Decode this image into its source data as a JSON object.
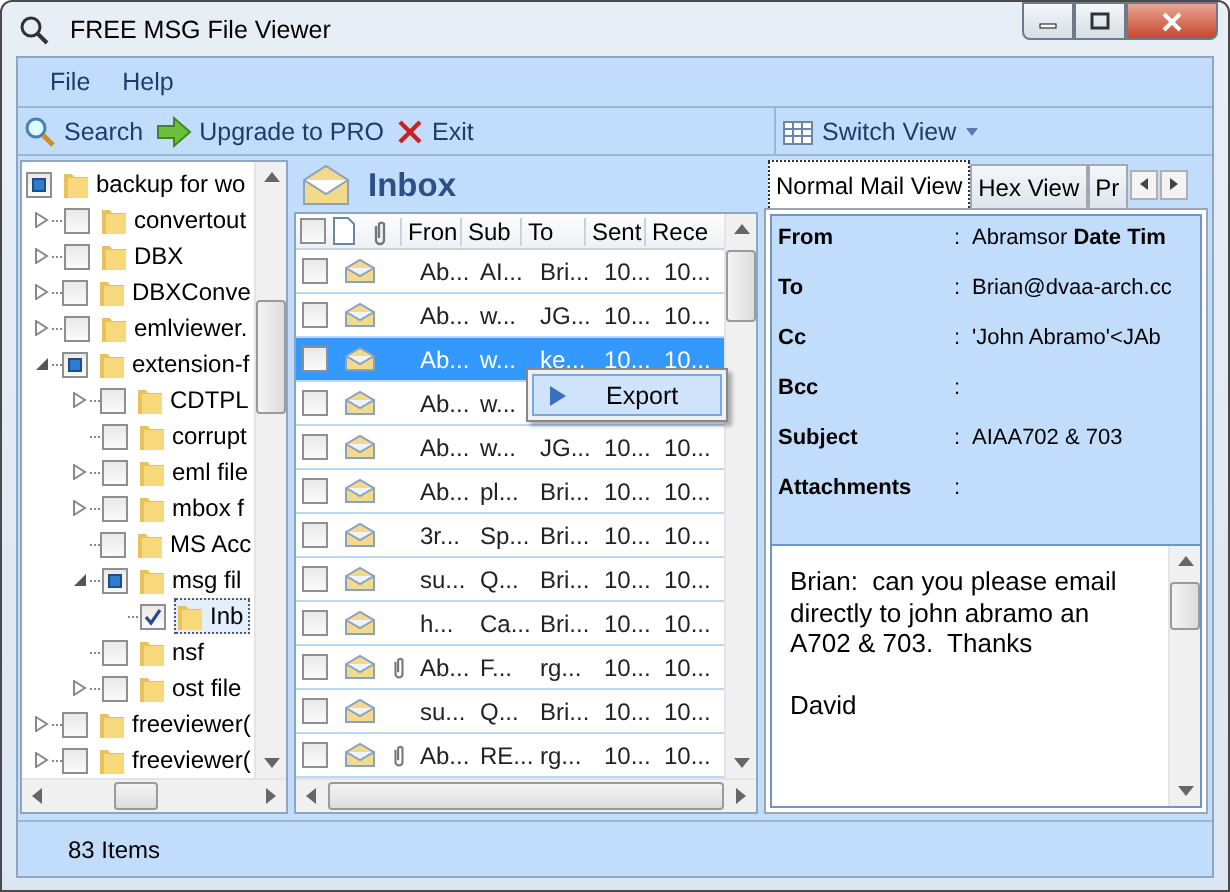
{
  "window": {
    "title": "FREE MSG File Viewer"
  },
  "menu": [
    "File",
    "Help"
  ],
  "toolbar": [
    {
      "kind": "search",
      "label": "Search"
    },
    {
      "kind": "upgrade",
      "label": "Upgrade to PRO"
    },
    {
      "kind": "exit",
      "label": "Exit"
    }
  ],
  "switch_view": {
    "label": "Switch View"
  },
  "tree": [
    {
      "label": "backup for wo",
      "checked": false,
      "partial": true,
      "selected": false,
      "children": [
        {
          "label": "convertout",
          "checked": false,
          "partial": false,
          "expanded": false,
          "selected": false
        },
        {
          "label": "DBX",
          "checked": false,
          "partial": false,
          "expanded": false,
          "selected": false
        },
        {
          "label": "DBXConve",
          "checked": false,
          "partial": false,
          "expanded": false,
          "selected": false
        },
        {
          "label": "emlviewer.",
          "checked": false,
          "partial": false,
          "expanded": false,
          "selected": false
        },
        {
          "label": "extension-f",
          "checked": false,
          "partial": true,
          "expanded": true,
          "selected": false,
          "children": [
            {
              "label": "CDTPL",
              "checked": false,
              "partial": false,
              "expanded": false,
              "selected": false
            },
            {
              "label": "corrupt",
              "checked": false,
              "partial": false,
              "selected": false
            },
            {
              "label": "eml file",
              "checked": false,
              "partial": false,
              "expanded": false,
              "selected": false
            },
            {
              "label": "mbox f",
              "checked": false,
              "partial": false,
              "expanded": false,
              "selected": false
            },
            {
              "label": "MS Acc",
              "checked": false,
              "partial": false,
              "selected": false
            },
            {
              "label": "msg fil",
              "checked": false,
              "partial": true,
              "expanded": true,
              "selected": false,
              "children": [
                {
                  "label": "Inb",
                  "checked": true,
                  "partial": false,
                  "selected": true
                }
              ]
            },
            {
              "label": "nsf",
              "checked": false,
              "partial": false,
              "selected": false
            },
            {
              "label": "ost file",
              "checked": false,
              "partial": false,
              "expanded": false,
              "selected": false
            }
          ]
        },
        {
          "label": "freeviewer(",
          "checked": false,
          "partial": false,
          "expanded": false,
          "selected": false
        },
        {
          "label": "freeviewer(",
          "checked": false,
          "partial": false,
          "expanded": false,
          "selected": false
        }
      ]
    }
  ],
  "inbox": {
    "title": "Inbox",
    "all_checked": false,
    "columns": [
      "Fron",
      "Sub",
      "To",
      "Sent",
      "Rece"
    ],
    "rows": [
      {
        "checked": false,
        "selected": false,
        "attachment": false,
        "cells": [
          "Ab...",
          "AI...",
          "Bri...",
          "10...",
          "10..."
        ]
      },
      {
        "checked": false,
        "selected": false,
        "attachment": false,
        "cells": [
          "Ab...",
          "w...",
          "JG...",
          "10...",
          "10..."
        ]
      },
      {
        "checked": false,
        "selected": true,
        "attachment": false,
        "cells": [
          "Ab...",
          "w...",
          "ke...",
          "10...",
          "10..."
        ]
      },
      {
        "checked": false,
        "selected": false,
        "attachment": false,
        "cells": [
          "Ab...",
          "w..."
        ]
      },
      {
        "checked": false,
        "selected": false,
        "attachment": false,
        "cells": [
          "Ab...",
          "w...",
          "JG...",
          "10...",
          "10..."
        ]
      },
      {
        "checked": false,
        "selected": false,
        "attachment": false,
        "cells": [
          "Ab...",
          "pl...",
          "Bri...",
          "10...",
          "10..."
        ]
      },
      {
        "checked": false,
        "selected": false,
        "attachment": false,
        "cells": [
          "3r...",
          "Sp...",
          "Bri...",
          "10...",
          "10..."
        ]
      },
      {
        "checked": false,
        "selected": false,
        "attachment": false,
        "cells": [
          "su...",
          "Q...",
          "Bri...",
          "10...",
          "10..."
        ]
      },
      {
        "checked": false,
        "selected": false,
        "attachment": false,
        "cells": [
          "h...",
          "Ca...",
          "Bri...",
          "10...",
          "10..."
        ]
      },
      {
        "checked": false,
        "selected": false,
        "attachment": true,
        "cells": [
          "Ab...",
          "F...",
          "rg...",
          "10...",
          "10..."
        ]
      },
      {
        "checked": false,
        "selected": false,
        "attachment": false,
        "cells": [
          "su...",
          "Q...",
          "Bri...",
          "10...",
          "10..."
        ]
      },
      {
        "checked": false,
        "selected": false,
        "attachment": true,
        "cells": [
          "Ab...",
          "RE...",
          "rg...",
          "10...",
          "10..."
        ]
      }
    ],
    "context_menu": [
      "Export"
    ]
  },
  "viewer": {
    "tabs": [
      {
        "label": "Normal Mail View",
        "selected": true
      },
      {
        "label": "Hex View",
        "selected": false
      },
      {
        "label": "Pr",
        "selected": false
      }
    ],
    "fields": [
      {
        "label": "From",
        "colon": ":",
        "value": "Abramsor"
      },
      {
        "label": "To",
        "colon": ":",
        "value": "Brian@dvaa-arch.cc"
      },
      {
        "label": "Cc",
        "colon": ":",
        "value": "'John Abramo'<JAb"
      },
      {
        "label": "Bcc",
        "colon": ":"
      },
      {
        "label": "Subject",
        "colon": ":",
        "value": "AIAA702 & 703"
      },
      {
        "label": "Attachments",
        "colon": ":"
      }
    ],
    "date_label": "Date Tim",
    "body": [
      [
        "Brian:  can you please email",
        "directly to john abramo an",
        "A702 & 703.  Thanks"
      ],
      [
        "David"
      ]
    ]
  },
  "status_bar": "83 Items"
}
